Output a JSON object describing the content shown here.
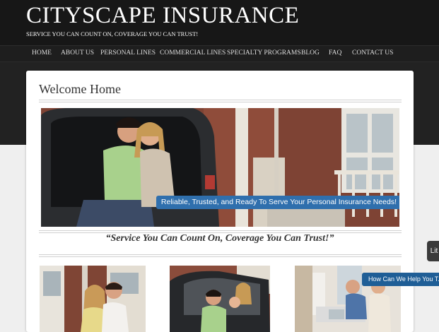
{
  "header": {
    "title": "CITYSCAPE INSURANCE",
    "tagline": "SERVICE YOU CAN COUNT ON, COVERAGE YOU CAN TRUST!"
  },
  "nav": {
    "items": [
      "HOME",
      "ABOUT US",
      "PERSONAL LINES",
      "COMMERCIAL LINES",
      "SPECIALTY PROGRAMS",
      "BLOG",
      "FAQ",
      "CONTACT US"
    ]
  },
  "main": {
    "welcome": "Welcome Home",
    "hero_banner": "Reliable, Trusted, and Ready To Serve Your Personal Insurance Needs!",
    "slogan": "“Service You Can Count On, Coverage You Can Trust!”"
  },
  "widgets": {
    "side_tab": "Lit",
    "help": "How Can We Help You T..."
  },
  "colors": {
    "header_bg": "#171717",
    "banner_blue": "#2f6fad",
    "help_blue": "#1f5e96"
  }
}
